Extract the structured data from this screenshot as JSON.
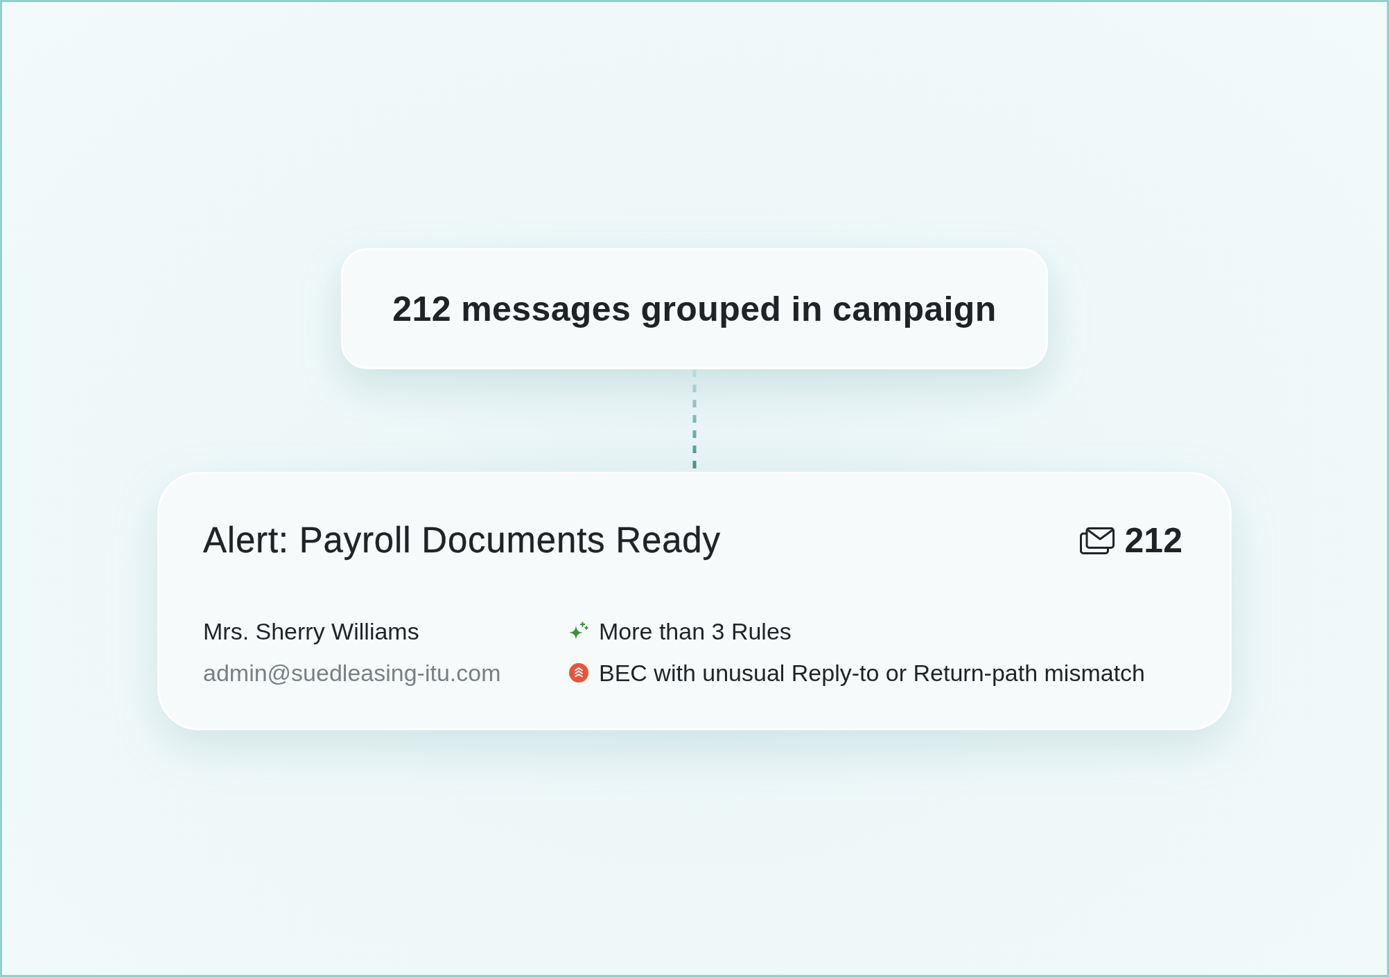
{
  "campaign_summary": {
    "text": "212 messages grouped in campaign"
  },
  "campaign_card": {
    "title": "Alert: Payroll Documents Ready",
    "message_count": "212",
    "sender": {
      "name": "Mrs. Sherry Williams",
      "email": "admin@suedleasing-itu.com"
    },
    "findings": [
      {
        "kind": "rules",
        "label": "More than 3 Rules"
      },
      {
        "kind": "threat",
        "label": "BEC with unusual Reply-to or Return-path mismatch"
      }
    ]
  }
}
